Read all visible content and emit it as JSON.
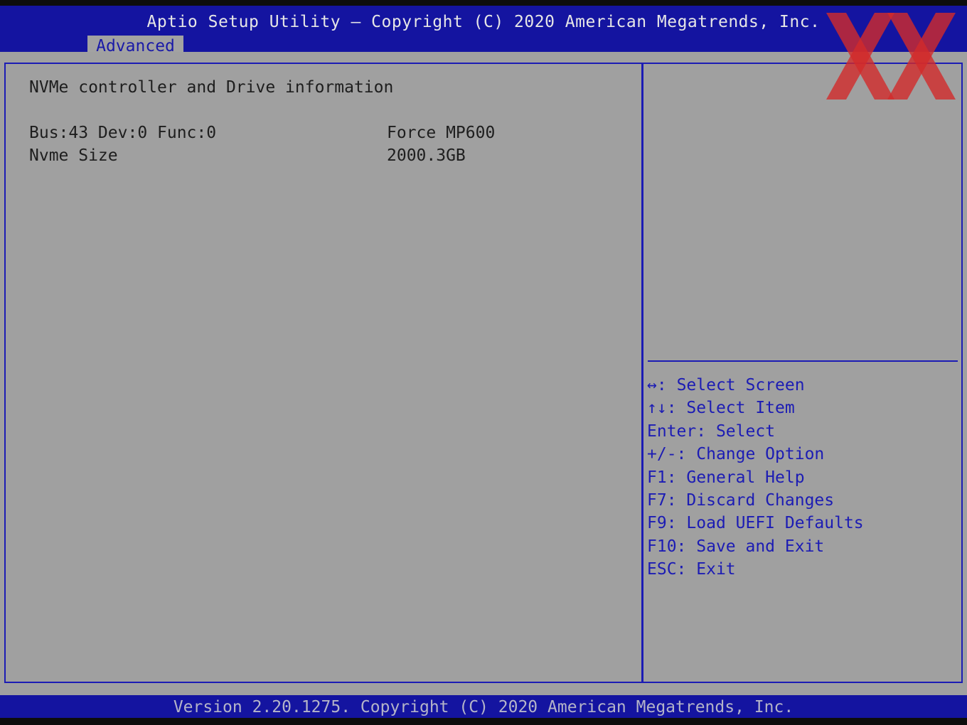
{
  "header": {
    "title": "Aptio Setup Utility – Copyright (C) 2020 American Megatrends, Inc.",
    "tabs": [
      {
        "label": "Advanced"
      }
    ]
  },
  "main": {
    "section_title": "NVMe controller and Drive information",
    "rows": [
      {
        "label": "Bus:43 Dev:0 Func:0",
        "value": "Force MP600"
      },
      {
        "label": "Nvme Size",
        "value": "2000.3GB"
      }
    ]
  },
  "help": {
    "description": "",
    "keys": [
      {
        "key": "↔:",
        "action": "Select Screen"
      },
      {
        "key": "↑↓:",
        "action": "Select Item"
      },
      {
        "key": "Enter:",
        "action": "Select"
      },
      {
        "key": "+/-:",
        "action": "Change Option"
      },
      {
        "key": "F1:",
        "action": "General Help"
      },
      {
        "key": "F7:",
        "action": "Discard Changes"
      },
      {
        "key": "F9:",
        "action": "Load UEFI Defaults"
      },
      {
        "key": "F10:",
        "action": "Save and Exit"
      },
      {
        "key": "ESC:",
        "action": "Exit"
      }
    ]
  },
  "footer": {
    "text": "Version 2.20.1275. Copyright (C) 2020 American Megatrends, Inc."
  },
  "logo": {
    "icon": "xx-watermark-logo",
    "color": "#d22a2a"
  },
  "colors": {
    "header_bg": "#1414a0",
    "panel_bg": "#a0a0a0",
    "accent_blue": "#1c1cb4",
    "text_dark": "#1e1e1e"
  }
}
